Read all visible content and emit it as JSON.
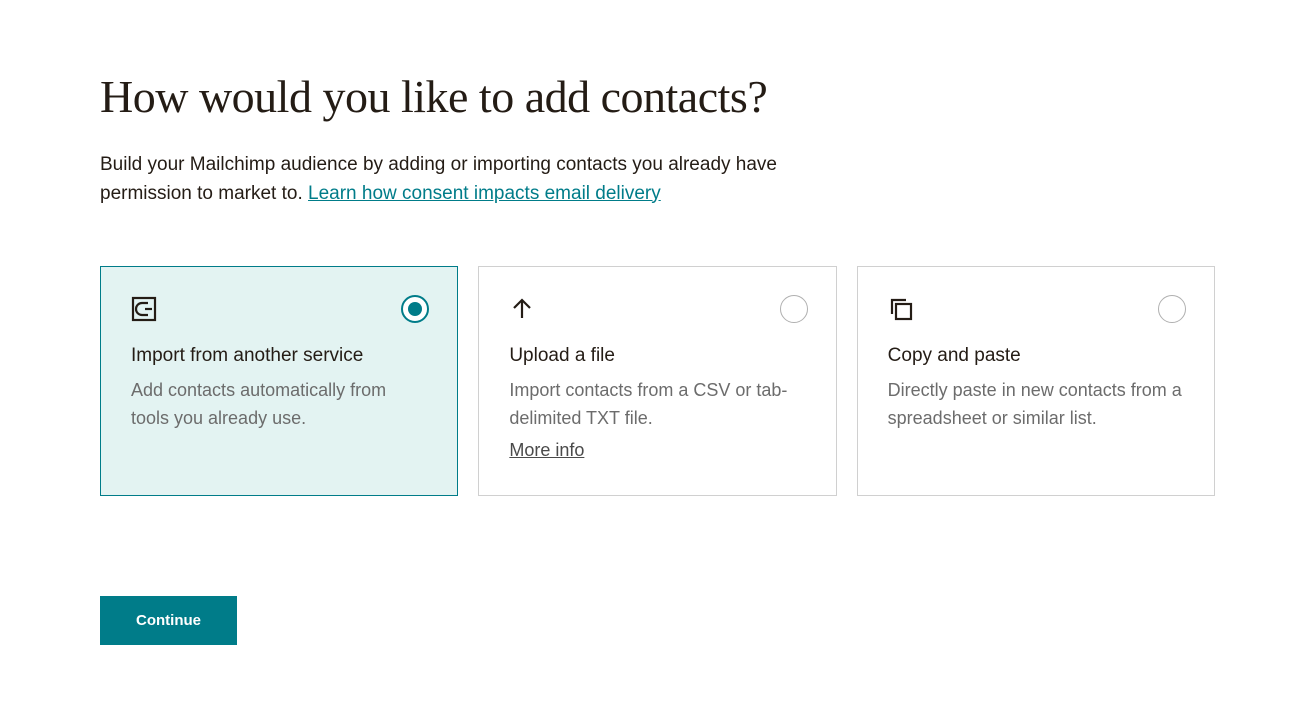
{
  "header": {
    "title": "How would you like to add contacts?",
    "subtitle_text": "Build your Mailchimp audience by adding or importing contacts you already have permission to market to. ",
    "subtitle_link": "Learn how consent impacts email delivery"
  },
  "options": [
    {
      "title": "Import from another service",
      "description": "Add contacts automatically from tools you already use.",
      "selected": true
    },
    {
      "title": "Upload a file",
      "description": "Import contacts from a CSV or tab-delimited TXT file.",
      "more_link": "More info",
      "selected": false
    },
    {
      "title": "Copy and paste",
      "description": "Directly paste in new contacts from a spreadsheet or similar list.",
      "selected": false
    }
  ],
  "actions": {
    "continue_label": "Continue"
  }
}
